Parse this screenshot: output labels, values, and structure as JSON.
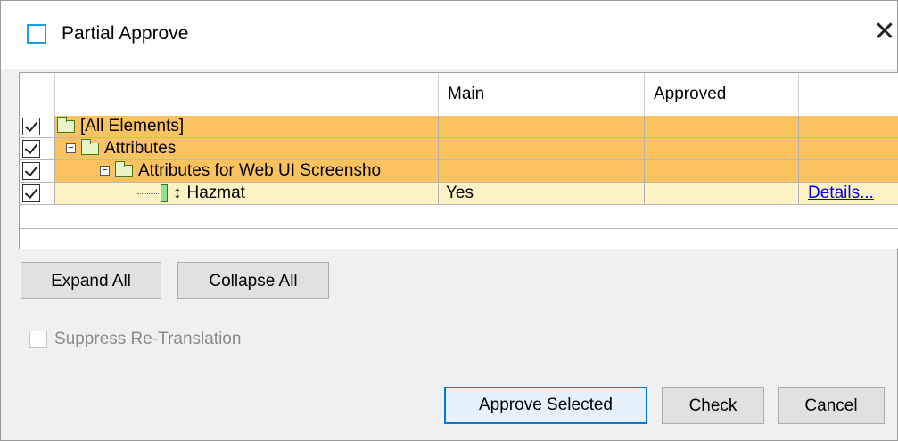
{
  "window": {
    "title": "Partial Approve",
    "close_glyph": "✕"
  },
  "grid": {
    "columns": [
      "",
      "Main",
      "Approved",
      ""
    ],
    "rows": [
      {
        "name": "[All Elements]",
        "main": "",
        "approved": "",
        "link": "",
        "level": 0,
        "checked": true,
        "style": "orange"
      },
      {
        "name": "Attributes",
        "main": "",
        "approved": "",
        "link": "",
        "level": 1,
        "checked": true,
        "style": "orange"
      },
      {
        "name": "Attributes for Web UI Screensho",
        "main": "",
        "approved": "",
        "link": "",
        "level": 2,
        "checked": true,
        "style": "orange"
      },
      {
        "name": "Hazmat",
        "main": "Yes",
        "approved": "",
        "link": "Details...",
        "level": 3,
        "checked": true,
        "style": "yellow"
      }
    ]
  },
  "buttons": {
    "expand_all": "Expand All",
    "collapse_all": "Collapse All",
    "approve_selected": "Approve Selected",
    "check": "Check",
    "cancel": "Cancel"
  },
  "options": {
    "suppress_label": "Suppress Re-Translation",
    "suppress_checked": false,
    "suppress_enabled": false
  },
  "colors": {
    "accent": "#0078d7",
    "row_orange": "#fbc35f",
    "row_yellow": "#fdf3c4",
    "title_icon": "#1ba1e2"
  }
}
